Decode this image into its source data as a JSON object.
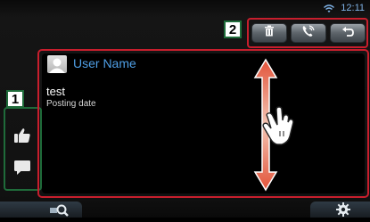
{
  "status_bar": {
    "time": "12:11",
    "wifi_icon": "wifi-icon"
  },
  "toolbar": {
    "badge": "2",
    "buttons": [
      {
        "icon": "trash-icon"
      },
      {
        "icon": "phone-icon"
      },
      {
        "icon": "back-arrow-icon"
      }
    ]
  },
  "sidebar": {
    "badge": "1",
    "buttons": [
      {
        "icon": "thumbs-up-icon"
      },
      {
        "icon": "comment-icon"
      }
    ]
  },
  "post": {
    "user_name": "User Name",
    "text": "test",
    "date": "Posting date"
  },
  "bottom_bar": {
    "left_icon": "search-icon",
    "right_icon": "gear-icon"
  },
  "colors": {
    "highlight_red": "#c81e2d",
    "highlight_green": "#1f6b3a",
    "user_name_blue": "#4f9fe6"
  }
}
